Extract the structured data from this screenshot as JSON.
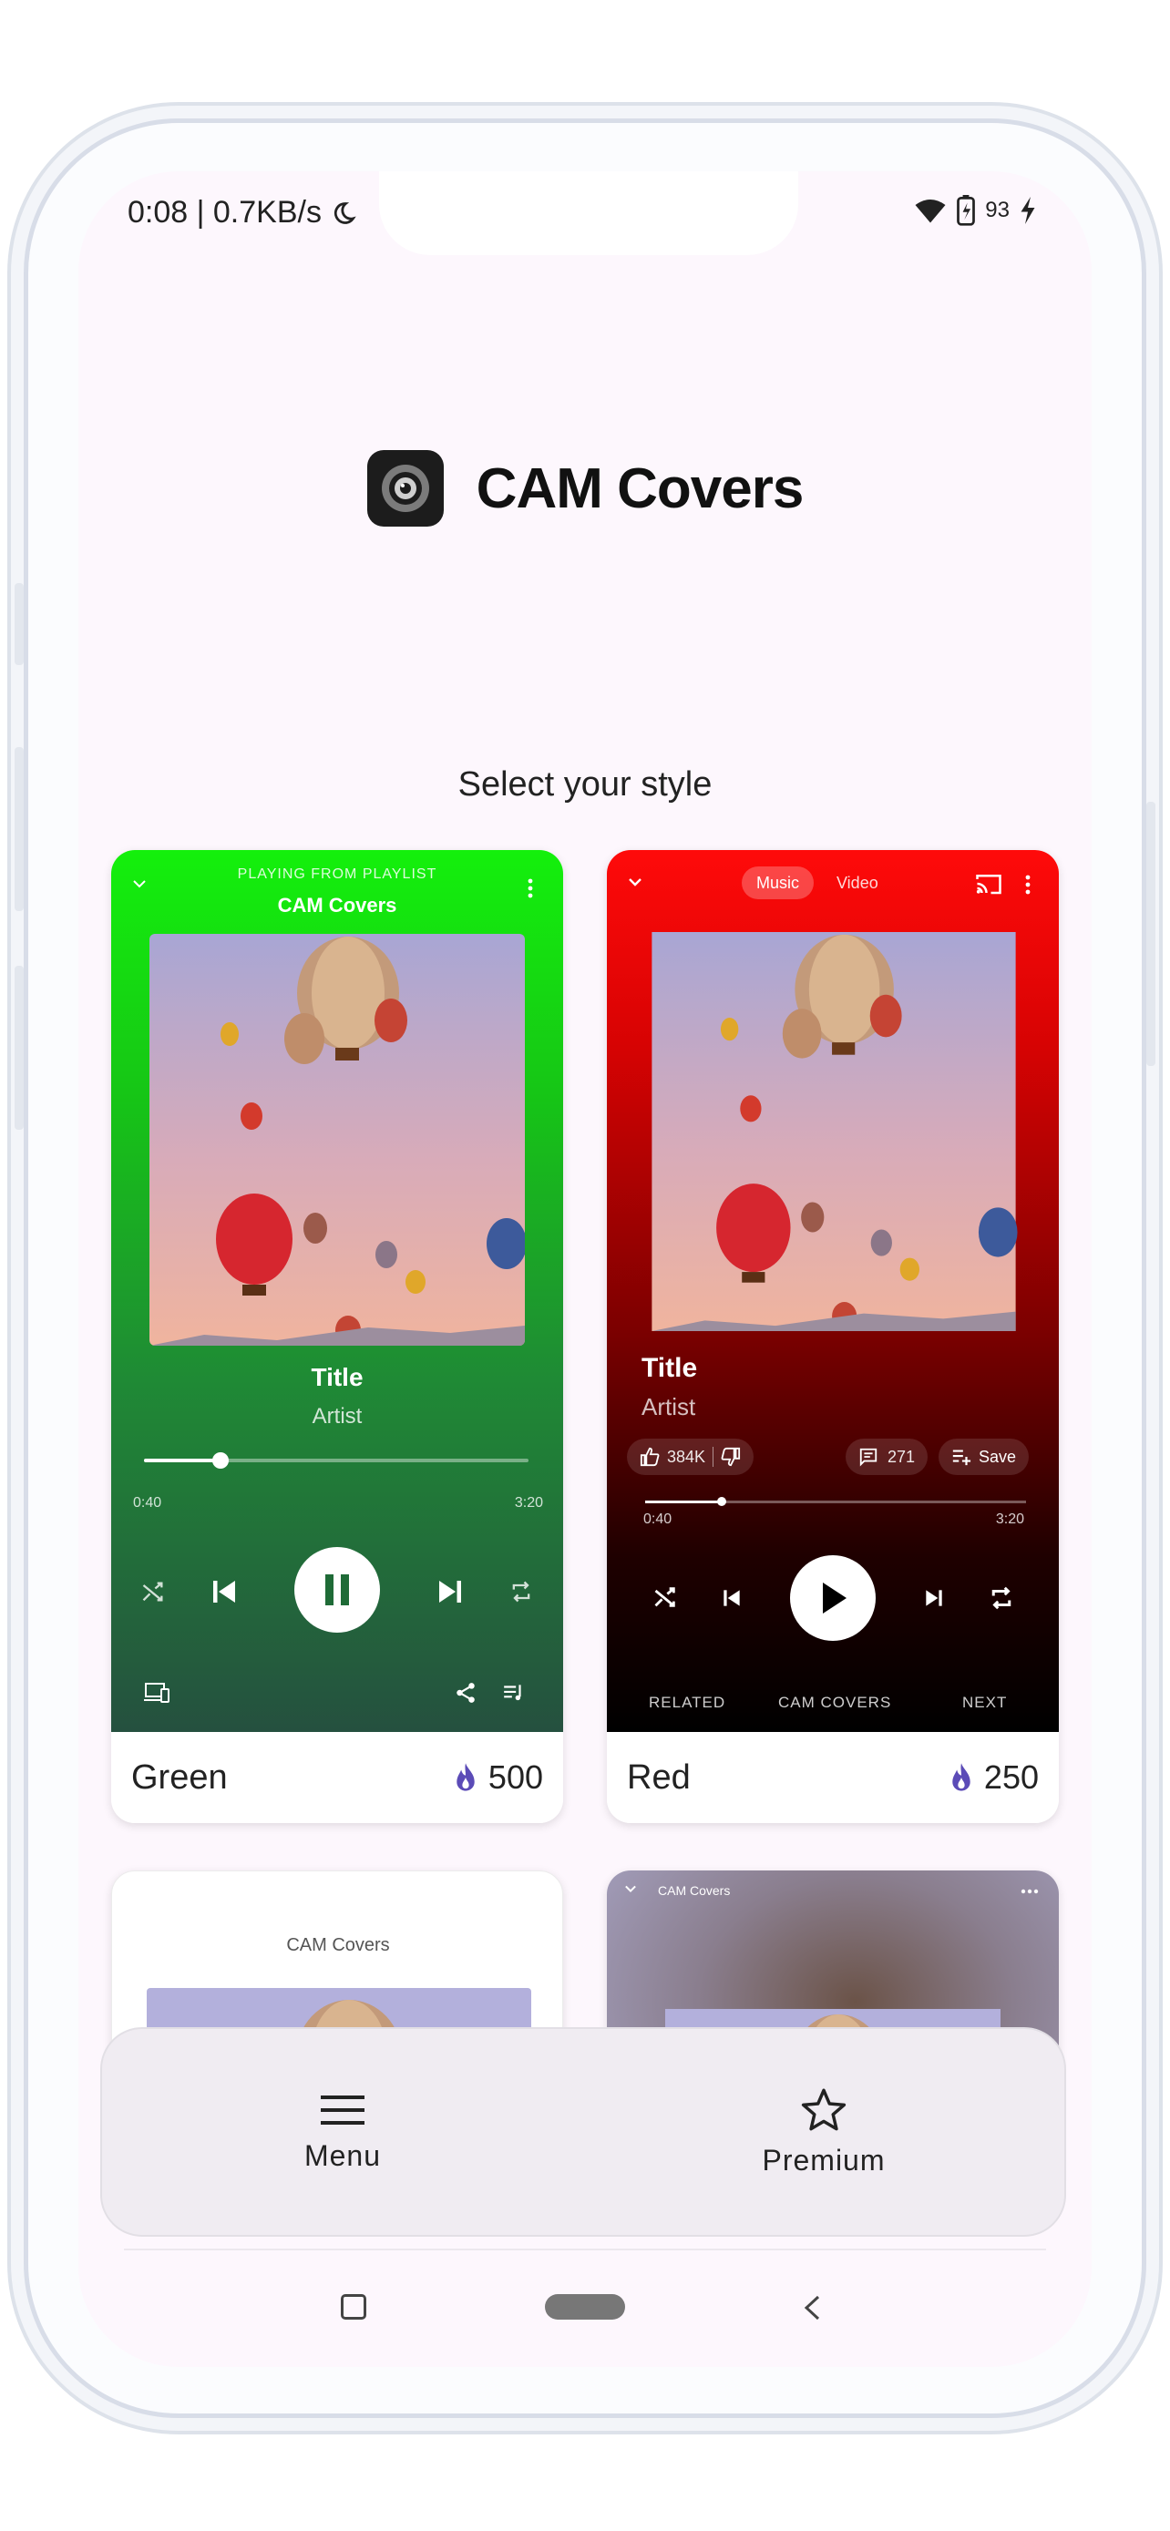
{
  "status_bar": {
    "time_speed": "0:08 | 0.7KB/s",
    "battery": "93"
  },
  "app": {
    "title": "CAM Covers"
  },
  "subtitle": "Select your style",
  "cards": {
    "green": {
      "header_small": "PLAYING FROM PLAYLIST",
      "header_title": "CAM Covers",
      "song_title": "Title",
      "artist": "Artist",
      "elapsed": "0:40",
      "duration": "3:20",
      "progress": 0.2,
      "name": "Green",
      "price": "500"
    },
    "red": {
      "tab_music": "Music",
      "tab_video": "Video",
      "song_title": "Title",
      "artist": "Artist",
      "likes": "384K",
      "comments": "271",
      "save": "Save",
      "elapsed": "0:40",
      "duration": "3:20",
      "progress": 0.2,
      "tab_related": "RELATED",
      "tab_covers": "CAM COVERS",
      "tab_next": "NEXT",
      "name": "Red",
      "price": "250"
    },
    "white": {
      "header_title": "CAM Covers"
    },
    "blur": {
      "header_title": "CAM Covers"
    }
  },
  "nav": {
    "menu": "Menu",
    "premium": "Premium"
  },
  "colors": {
    "green": "#14f00c",
    "red": "#ff0a0a",
    "accent": "#5b4bb7"
  }
}
